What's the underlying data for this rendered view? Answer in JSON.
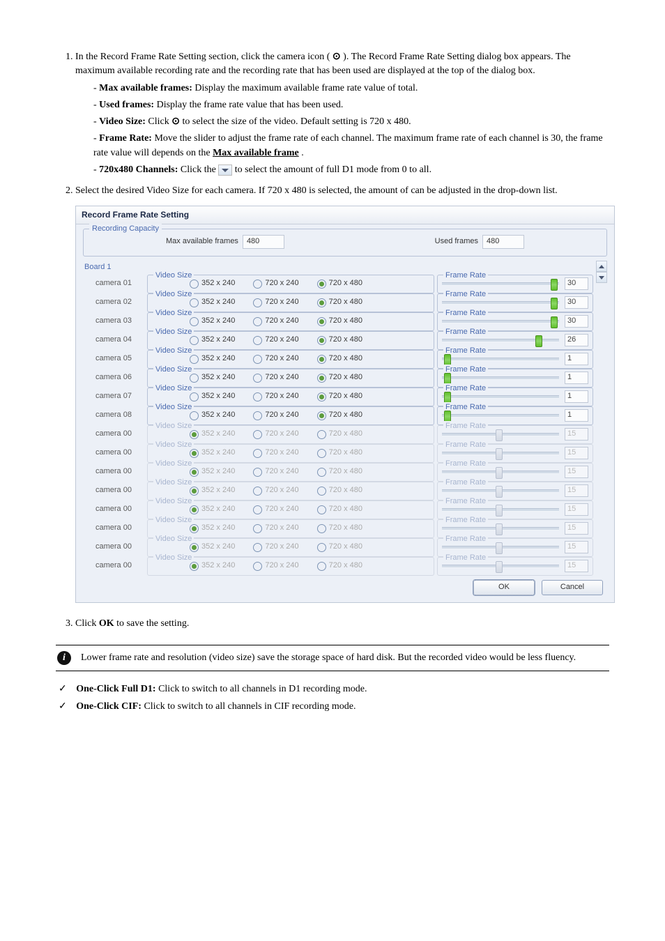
{
  "instructions": {
    "step1": "In the Record Frame Rate Setting section, click the camera icon (    ). The Record Frame Rate Setting dialog box appears. The maximum available recording rate and the recording rate that has been used are displayed at the top of the dialog box.",
    "step2": "Select the desired Video Size for each camera. If 720 x 480 is selected, the amount of can be adjusted in the drop-down list.",
    "dash_items": [
      {
        "label": "Max available frames:",
        "text": "Display the maximum available frame rate value of total."
      },
      {
        "label": "Used frames:",
        "text": "Display the frame rate value that has been used."
      },
      {
        "label": "Video Size:",
        "text": "Click    to select the size of the video. Default setting is 720 x 480."
      },
      {
        "label": "Frame Rate:",
        "text": "Move the slider to adjust the frame rate of each channel. The maximum frame rate of each channel is 30, the frame rate value will depends on the ",
        "link": "Max available frame",
        "tail": "."
      },
      {
        "label": "720x480 Channels:",
        "text": "Click the    to select the amount of full D1 mode from 0 to all."
      }
    ],
    "step3": "Click OK to save the setting."
  },
  "dialog": {
    "title": "Record Frame Rate Setting",
    "capacity_group": "Recording Capacity",
    "max_label": "Max available frames",
    "max_value": "480",
    "used_label": "Used frames",
    "used_value": "480",
    "board": "Board 1",
    "vs_legend": "Video Size",
    "fr_legend": "Frame Rate",
    "sizes": [
      "352 x 240",
      "720 x 240",
      "720 x 480"
    ],
    "cameras": [
      {
        "name": "camera 01",
        "enabled": true,
        "sel": 2,
        "rate": "30",
        "pos": 93
      },
      {
        "name": "camera 02",
        "enabled": true,
        "sel": 2,
        "rate": "30",
        "pos": 93
      },
      {
        "name": "camera 03",
        "enabled": true,
        "sel": 2,
        "rate": "30",
        "pos": 93
      },
      {
        "name": "camera 04",
        "enabled": true,
        "sel": 2,
        "rate": "26",
        "pos": 80
      },
      {
        "name": "camera 05",
        "enabled": true,
        "sel": 2,
        "rate": "1",
        "pos": 2
      },
      {
        "name": "camera 06",
        "enabled": true,
        "sel": 2,
        "rate": "1",
        "pos": 2
      },
      {
        "name": "camera 07",
        "enabled": true,
        "sel": 2,
        "rate": "1",
        "pos": 2
      },
      {
        "name": "camera 08",
        "enabled": true,
        "sel": 2,
        "rate": "1",
        "pos": 2
      },
      {
        "name": "camera 00",
        "enabled": false,
        "sel": 0,
        "rate": "15",
        "pos": 46
      },
      {
        "name": "camera 00",
        "enabled": false,
        "sel": 0,
        "rate": "15",
        "pos": 46
      },
      {
        "name": "camera 00",
        "enabled": false,
        "sel": 0,
        "rate": "15",
        "pos": 46
      },
      {
        "name": "camera 00",
        "enabled": false,
        "sel": 0,
        "rate": "15",
        "pos": 46
      },
      {
        "name": "camera 00",
        "enabled": false,
        "sel": 0,
        "rate": "15",
        "pos": 46
      },
      {
        "name": "camera 00",
        "enabled": false,
        "sel": 0,
        "rate": "15",
        "pos": 46
      },
      {
        "name": "camera 00",
        "enabled": false,
        "sel": 0,
        "rate": "15",
        "pos": 46
      },
      {
        "name": "camera 00",
        "enabled": false,
        "sel": 0,
        "rate": "15",
        "pos": 46
      }
    ],
    "ok": "OK",
    "cancel": "Cancel"
  },
  "note": "Lower frame rate and resolution (video size) save the storage space of hard disk. But the recorded video would be less fluency.",
  "bullets": [
    {
      "label": "One-Click Full D1:",
      "text": "Click to switch to all channels in D1 recording mode."
    },
    {
      "label": "One-Click CIF:",
      "text": "Click to switch to all channels in CIF recording mode."
    }
  ]
}
